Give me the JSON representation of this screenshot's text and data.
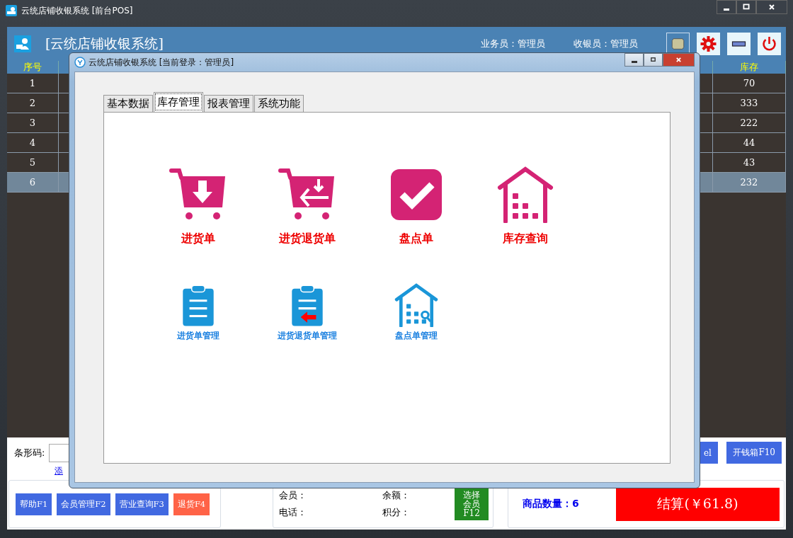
{
  "window": {
    "title": "云统店铺收银系统 [前台POS]"
  },
  "header": {
    "title": "[云统店铺收银系统]",
    "salesperson": "业务员：管理员",
    "cashier": "收银员：管理员"
  },
  "table": {
    "columns": [
      "序号",
      "库存"
    ],
    "rows": [
      {
        "cells": [
          "1",
          "70"
        ],
        "selected": false
      },
      {
        "cells": [
          "2",
          "333"
        ],
        "selected": false
      },
      {
        "cells": [
          "3",
          "222"
        ],
        "selected": false
      },
      {
        "cells": [
          "4",
          "44"
        ],
        "selected": false
      },
      {
        "cells": [
          "5",
          "43"
        ],
        "selected": false
      },
      {
        "cells": [
          "6",
          "232"
        ],
        "selected": true
      }
    ]
  },
  "barcode": {
    "label": "条形码:",
    "link": "添"
  },
  "action_buttons": [
    "el",
    "开钱箱F10"
  ],
  "function_buttons": [
    {
      "label": "帮助F1",
      "kind": "normal"
    },
    {
      "label": "会员管理F2",
      "kind": "normal"
    },
    {
      "label": "营业查询F3",
      "kind": "normal"
    },
    {
      "label": "退货F4",
      "kind": "danger"
    }
  ],
  "member": {
    "fields": [
      "会员：",
      "余额：",
      "电话：",
      "积分："
    ],
    "select_button": "选择会员F12"
  },
  "summary": {
    "count": "商品数量：6",
    "checkout": "结算(￥61.8)"
  },
  "dialog": {
    "title": "云统店铺收银系统 [当前登录：管理员]",
    "tabs": [
      {
        "label": "基本数据",
        "selected": false
      },
      {
        "label": "库存管理",
        "selected": true
      },
      {
        "label": "报表管理",
        "selected": false
      },
      {
        "label": "系统功能",
        "selected": false
      }
    ],
    "tile_rows": [
      {
        "tiles": [
          {
            "label": "进货单",
            "kind": "cart-in"
          },
          {
            "label": "进货退货单",
            "kind": "cart-return"
          },
          {
            "label": "盘点单",
            "kind": "check"
          },
          {
            "label": "库存查询",
            "kind": "warehouse"
          }
        ]
      },
      {
        "tiles": [
          {
            "label": "进货单管理",
            "kind": "clipboard"
          },
          {
            "label": "进货退货单管理",
            "kind": "clipboard-return"
          },
          {
            "label": "盘点单管理",
            "kind": "warehouse-search"
          }
        ]
      }
    ]
  }
}
